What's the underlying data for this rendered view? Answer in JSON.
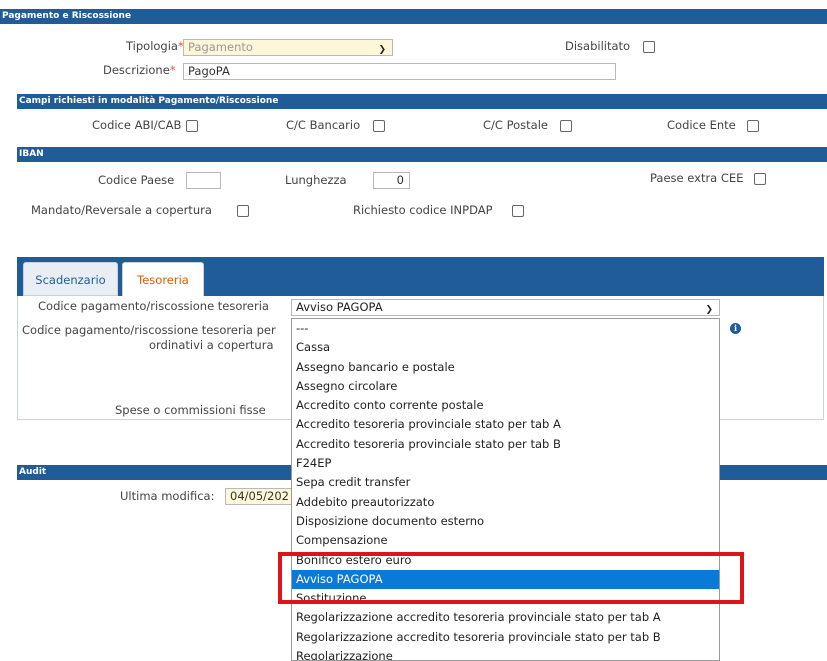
{
  "header": {
    "title": "Pagamento e Riscossione"
  },
  "main_form": {
    "tipologia_label": "Tipologia",
    "tipologia_value": "Pagamento",
    "descrizione_label": "Descrizione",
    "descrizione_value": "PagoPA",
    "disabilitato_label": "Disabilitato",
    "required_mark": "*"
  },
  "campi_section": {
    "title": "Campi richiesti in modalità Pagamento/Riscossione",
    "codice_abi_cab": "Codice ABI/CAB",
    "cc_bancario": "C/C Bancario",
    "cc_postale": "C/C Postale",
    "codice_ente": "Codice Ente"
  },
  "iban_section": {
    "title": "IBAN",
    "codice_paese": "Codice Paese",
    "lunghezza": "Lunghezza",
    "lunghezza_value": "0",
    "paese_extra_cee": "Paese extra CEE",
    "mandato_reversale": "Mandato/Reversale a copertura",
    "richiesto_inpdap": "Richiesto codice INPDAP"
  },
  "tabs": [
    {
      "label": "Scadenzario",
      "active": false
    },
    {
      "label": "Tesoreria",
      "active": true
    }
  ],
  "tesoreria": {
    "codice_pagamento_label": "Codice pagamento/riscossione tesoreria",
    "codice_pagamento_value": "Avviso PAGOPA",
    "codice_ordinativi_label_1": "Codice pagamento/riscossione tesoreria per",
    "codice_ordinativi_label_2": "ordinativi a copertura",
    "spese_label": "Spese o commissioni fisse"
  },
  "audit": {
    "title": "Audit",
    "ultima_modifica_label": "Ultima modifica:",
    "ultima_modifica_value": "04/05/202"
  },
  "dropdown": {
    "options": [
      "---",
      "Cassa",
      "Assegno bancario e postale",
      "Assegno circolare",
      "Accredito conto corrente postale",
      "Accredito tesoreria provinciale stato per tab A",
      "Accredito tesoreria provinciale stato per tab B",
      "F24EP",
      "Sepa credit transfer",
      "Addebito preautorizzato",
      "Disposizione documento esterno",
      "Compensazione",
      "Bonifico estero euro",
      "Avviso PAGOPA",
      "Sostituzione",
      "Regolarizzazione accredito tesoreria provinciale stato per tab A",
      "Regolarizzazione accredito tesoreria provinciale stato per tab B",
      "Regolarizzazione"
    ],
    "selected_index": 13
  },
  "colors": {
    "section_bar": "#1f5c98",
    "select_highlight": "#0a7ad8",
    "annotation_red": "#e0131a",
    "tipologia_bg": "#fdf6d8",
    "active_tab_text": "#e05a00"
  },
  "icons": {
    "info": "info-icon",
    "dropdown_arrow": "chevron-down-icon"
  }
}
